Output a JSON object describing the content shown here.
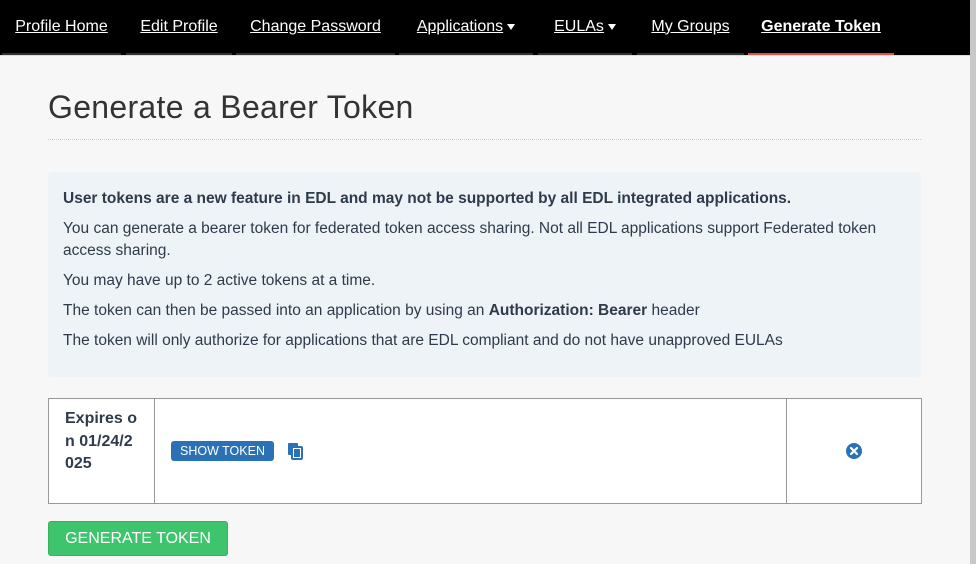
{
  "nav": {
    "items": [
      {
        "label": "Profile Home",
        "dropdown": false,
        "active": false
      },
      {
        "label": "Edit Profile",
        "dropdown": false,
        "active": false
      },
      {
        "label": "Change Password",
        "dropdown": false,
        "active": false
      },
      {
        "label": "Applications",
        "dropdown": true,
        "active": false
      },
      {
        "label": "EULAs",
        "dropdown": true,
        "active": false
      },
      {
        "label": "My Groups",
        "dropdown": false,
        "active": false
      },
      {
        "label": "Generate Token",
        "dropdown": false,
        "active": true
      }
    ]
  },
  "page": {
    "title": "Generate a Bearer Token"
  },
  "info": {
    "notice": "User tokens are a new feature in EDL and may not be supported by all EDL integrated applications.",
    "line1": "You can generate a bearer token for federated token access sharing. Not all EDL applications support Federated token access sharing.",
    "line2": "You may have up to 2 active tokens at a time.",
    "line3_before": "The token can then be passed into an application by using an ",
    "line3_bold": "Authorization: Bearer",
    "line3_after": " header",
    "line4": "The token will only authorize for applications that are EDL compliant and do not have unapproved EULAs"
  },
  "tokens": [
    {
      "expires_label": "Expires on 01/24/2025",
      "show_label": "SHOW TOKEN",
      "copy_icon": "copy-icon",
      "remove_icon": "remove-circle-icon"
    }
  ],
  "actions": {
    "generate_label": "GENERATE TOKEN"
  },
  "colors": {
    "nav_bg": "#000000",
    "active_underline": "#d9534f",
    "show_button": "#2a72b5",
    "generate_button": "#3ec46d",
    "info_bg": "#edf3f7"
  }
}
